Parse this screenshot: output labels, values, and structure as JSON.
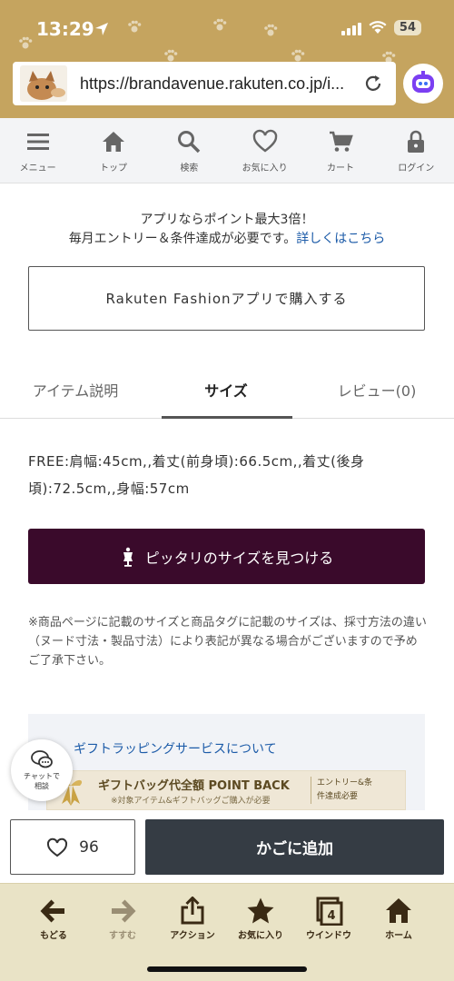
{
  "status_bar": {
    "time": "13:29",
    "battery": "54"
  },
  "browser": {
    "url": "https://brandavenue.rakuten.co.jp/i..."
  },
  "site_nav": {
    "items": [
      {
        "label": "メニュー",
        "icon": "menu-icon"
      },
      {
        "label": "トップ",
        "icon": "home-icon"
      },
      {
        "label": "検索",
        "icon": "search-icon"
      },
      {
        "label": "お気に入り",
        "icon": "heart-icon"
      },
      {
        "label": "カート",
        "icon": "cart-icon"
      },
      {
        "label": "ログイン",
        "icon": "lock-icon"
      }
    ]
  },
  "promo": {
    "line1": "アプリならポイント最大3倍！",
    "line2": "毎月エントリー＆条件達成が必要です。",
    "link": "詳しくはこちら"
  },
  "app_button": {
    "label": "Rakuten Fashionアプリで購入する"
  },
  "tabs": [
    {
      "label": "アイテム説明",
      "active": false
    },
    {
      "label": "サイズ",
      "active": true
    },
    {
      "label": "レビュー(0)",
      "active": false
    }
  ],
  "size_text": "FREE:肩幅:45cm,,着丈(前身頃):66.5cm,,着丈(後身頃):72.5cm,,身幅:57cm",
  "fit_button": {
    "label": "ピッタリのサイズを見つける",
    "color": "#3a0a2b"
  },
  "note": "※商品ページに記載のサイズと商品タグに記載のサイズは、採寸方法の違い（ヌード寸法・製品寸法）により表記が異なる場合がございますので予めご了承下さい。",
  "gift": {
    "title": "ギフトラッピングサービスについて",
    "banner_main": "ギフトバッグ代全額 POINT BACK",
    "banner_sub": "※対象アイテム&ギフトバッグご購入が必要",
    "banner_right": "エントリー&条件達成必要"
  },
  "chat": {
    "label_line1": "チャットで",
    "label_line2": "相談"
  },
  "buy_bar": {
    "favorite_count": "96",
    "cart_label": "かごに追加",
    "cart_color": "#353c44"
  },
  "browser_toolbar": {
    "items": [
      {
        "label": "もどる",
        "icon": "back-arrow-icon",
        "enabled": true
      },
      {
        "label": "すすむ",
        "icon": "forward-arrow-icon",
        "enabled": false
      },
      {
        "label": "アクション",
        "icon": "share-icon",
        "enabled": true
      },
      {
        "label": "お気に入り",
        "icon": "star-icon",
        "enabled": true
      },
      {
        "label": "ウインドウ",
        "icon": "windows-icon",
        "enabled": true,
        "badge": "4"
      },
      {
        "label": "ホーム",
        "icon": "home-icon",
        "enabled": true
      }
    ]
  }
}
